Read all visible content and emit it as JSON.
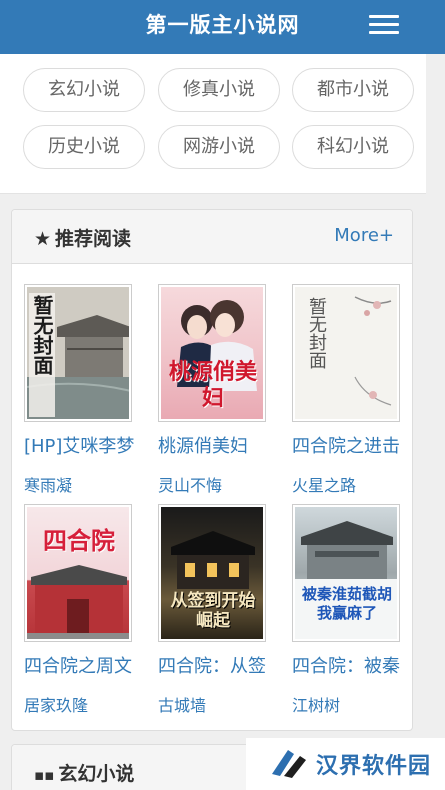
{
  "header": {
    "title": "第一版主小说网",
    "menu_icon": "hamburger-menu-icon"
  },
  "categories": [
    "玄幻小说",
    "修真小说",
    "都市小说",
    "历史小说",
    "网游小说",
    "科幻小说"
  ],
  "recommend": {
    "title": "推荐阅读",
    "icon": "star-icon",
    "more": "More+",
    "books": [
      {
        "title": "[HP]艾咪李梦",
        "author": "寒雨凝",
        "cover_text": "暂无封面"
      },
      {
        "title": "桃源俏美妇",
        "author": "灵山不悔",
        "cover_text": "桃源俏美妇"
      },
      {
        "title": "四合院之进击",
        "author": "火星之路",
        "cover_text": "暂无封面"
      },
      {
        "title": "四合院之周文",
        "author": "居家玖隆",
        "cover_text": "四合院"
      },
      {
        "title": "四合院：从签",
        "author": "古城墙",
        "cover_text": "从签到开始崛起"
      },
      {
        "title": "四合院：被秦",
        "author": "江树树",
        "cover_text": "被秦淮茹截胡我赢麻了"
      }
    ]
  },
  "section2": {
    "title": "玄幻小说",
    "icon": "grid-icon"
  },
  "watermark": {
    "text": "汉界软件园"
  },
  "colors": {
    "brand": "#337ab7"
  }
}
